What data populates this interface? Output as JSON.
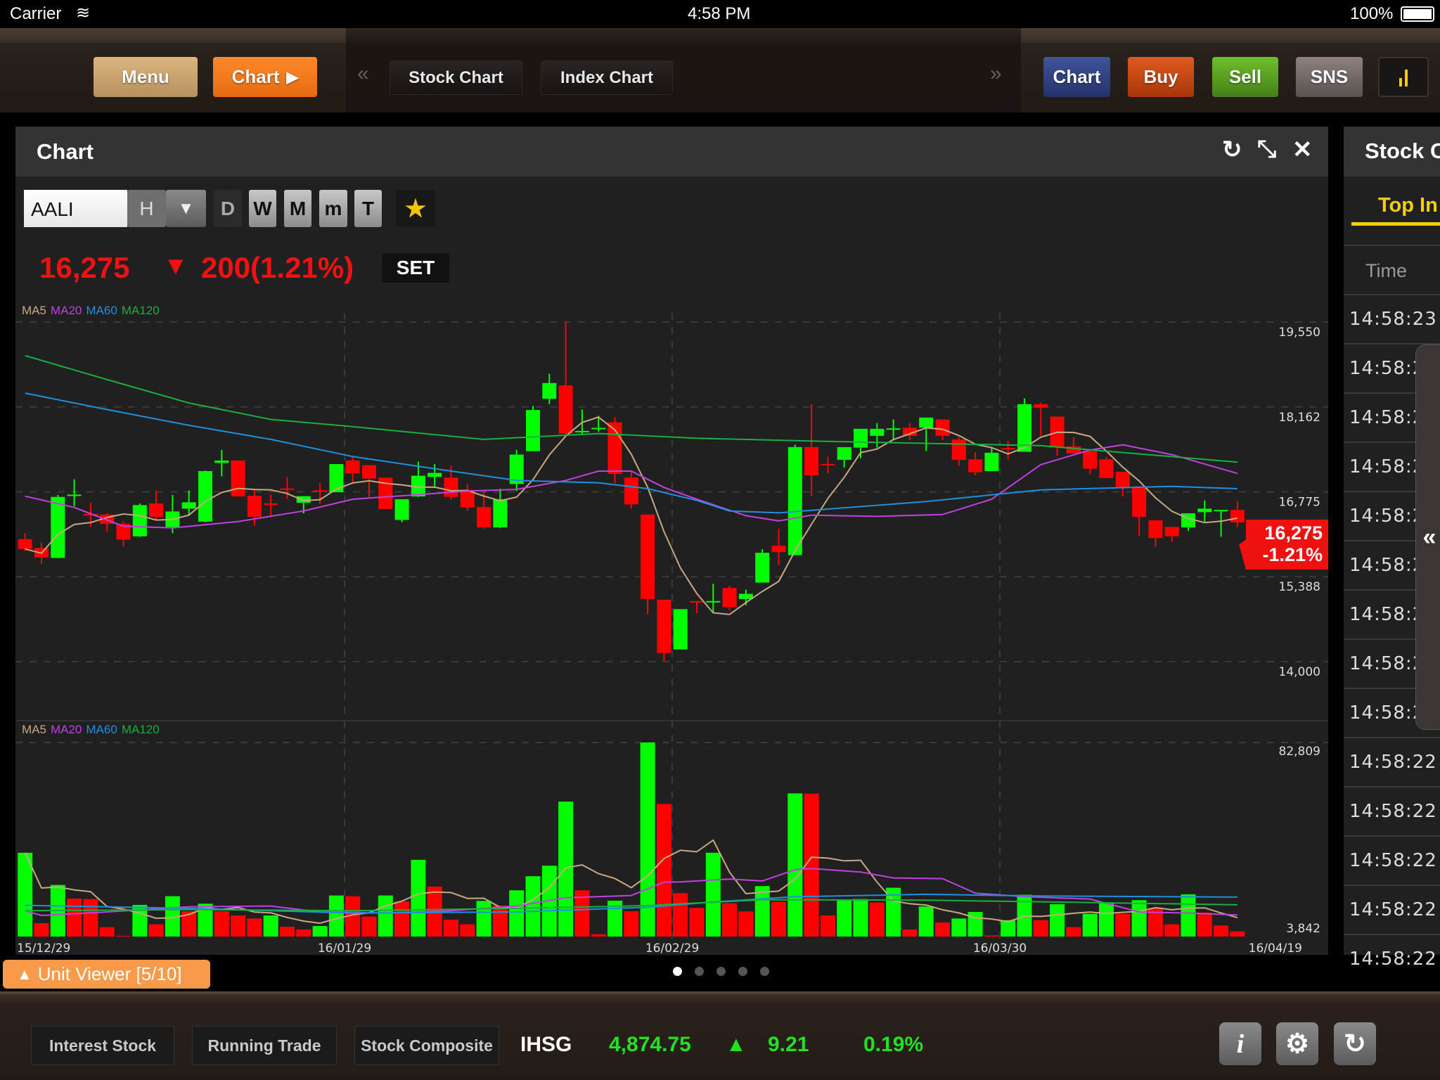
{
  "status_bar": {
    "carrier": "Carrier",
    "time": "4:58 PM",
    "battery": "100%"
  },
  "top_toolbar": {
    "menu": "Menu",
    "chart": "Chart",
    "chart_arrow": "▶",
    "prev": "«",
    "next": "»",
    "tabs": [
      "Stock Chart",
      "Index Chart"
    ],
    "right_buttons": [
      {
        "label": "Chart",
        "color": "#2d3e80"
      },
      {
        "label": "Buy",
        "color": "#c7420c"
      },
      {
        "label": "Sell",
        "color": "#4e9a1a"
      },
      {
        "label": "SNS",
        "color": "#6e6563"
      }
    ],
    "signal_icon": "bar-signal-icon"
  },
  "chart_panel": {
    "title": "Chart",
    "refresh_icon": "↻",
    "collapse_icon": "⤡",
    "close_icon": "✕",
    "symbol": "AALI",
    "period_selected": "H",
    "dropdown_icon": "▼",
    "periods": [
      "D",
      "W",
      "M",
      "m",
      "T"
    ],
    "favorite_icon": "★",
    "price": "16,275",
    "change_arrow": "▼",
    "change": "200(1.21%)",
    "market": "SET",
    "ma_legend": [
      {
        "label": "MA5",
        "color": "#c8a883"
      },
      {
        "label": "MA20",
        "color": "#c040e0"
      },
      {
        "label": "MA60",
        "color": "#1e90e0"
      },
      {
        "label": "MA120",
        "color": "#18b040"
      }
    ],
    "price_tag": {
      "price": "16,275",
      "change": "-1.21%"
    },
    "page_dots": {
      "count": 5,
      "active": 1
    }
  },
  "unit_viewer": {
    "icon": "▲",
    "label": "Unit Viewer [5/10]"
  },
  "right_panel": {
    "title": "Stock C",
    "tab": "Top In",
    "column": "Time",
    "times": [
      "14:58:23",
      "14:58:2",
      "14:58:2",
      "14:58:2",
      "14:58:2",
      "14:58:2",
      "14:58:2",
      "14:58:2",
      "14:58:2",
      "14:58:22",
      "14:58:22",
      "14:58:22",
      "14:58:22",
      "14:58:22"
    ],
    "handle_icon": "«"
  },
  "bottom_bar": {
    "buttons": [
      "Interest Stock",
      "Running Trade",
      "Stock Composite"
    ],
    "index_name": "IHSG",
    "index_value": "4,874.75",
    "index_arrow": "▲",
    "index_change": "9.21",
    "index_pct": "0.19%",
    "icons": [
      {
        "name": "info-icon",
        "glyph": "i"
      },
      {
        "name": "gear-icon",
        "glyph": "⚙"
      },
      {
        "name": "logout-icon",
        "glyph": "↻"
      }
    ]
  },
  "chart_data": [
    {
      "type": "candlestick",
      "ohlc_order": [
        "open",
        "high",
        "low",
        "close"
      ],
      "up_color": "#00ff00",
      "down_color": "#ff0000",
      "ylim": [
        14000,
        19550
      ],
      "y_ticks": [
        "19,550",
        "18,162",
        "16,775",
        "15,388",
        "14,000"
      ],
      "y_tick_values": [
        19550,
        18162,
        16775,
        15388,
        14000
      ],
      "x_labels": [
        {
          "index": 0,
          "label": "15/12/29"
        },
        {
          "index": 19.5,
          "label": "16/01/29"
        },
        {
          "index": 39.5,
          "label": "16/02/29"
        },
        {
          "index": 59.5,
          "label": "16/03/30"
        },
        {
          "index": 74,
          "label": "16/04/19"
        }
      ],
      "ohlc": [
        [
          16002,
          16098,
          15810,
          15841
        ],
        [
          15856,
          15944,
          15599,
          15703
        ],
        [
          15695,
          16723,
          15687,
          16692
        ],
        [
          16715,
          16980,
          16539,
          16730
        ],
        [
          16414,
          16596,
          16201,
          16400
        ],
        [
          16404,
          16424,
          16124,
          16251
        ],
        [
          16251,
          16290,
          15879,
          15994
        ],
        [
          16048,
          16585,
          16040,
          16558
        ],
        [
          16585,
          16796,
          16316,
          16366
        ],
        [
          16201,
          16723,
          16098,
          16454
        ],
        [
          16500,
          16796,
          16385,
          16604
        ],
        [
          16289,
          17122,
          16278,
          17114
        ],
        [
          17248,
          17460,
          17030,
          17286
        ],
        [
          17287,
          17287,
          16700,
          16700
        ],
        [
          16711,
          16808,
          16224,
          16366
        ],
        [
          16585,
          16731,
          16366,
          16570
        ],
        [
          16830,
          17018,
          16654,
          16815
        ],
        [
          16596,
          16704,
          16424,
          16704
        ],
        [
          16800,
          16922,
          16577,
          16780
        ],
        [
          16769,
          17229,
          16769,
          17229
        ],
        [
          17287,
          17345,
          16922,
          17076
        ],
        [
          17210,
          17210,
          16692,
          16992
        ],
        [
          17007,
          17007,
          16493,
          16493
        ],
        [
          16316,
          16654,
          16278,
          16654
        ],
        [
          16700,
          17268,
          16692,
          17038
        ],
        [
          17019,
          17229,
          16865,
          17084
        ],
        [
          17007,
          17199,
          16654,
          16692
        ],
        [
          16807,
          16903,
          16470,
          16520
        ],
        [
          16527,
          16796,
          16174,
          16194
        ],
        [
          16194,
          16826,
          16182,
          16654
        ],
        [
          16903,
          17460,
          16788,
          17383
        ],
        [
          17440,
          18181,
          17440,
          18112
        ],
        [
          18296,
          18706,
          18207,
          18553
        ],
        [
          18514,
          19550,
          17709,
          17728
        ],
        [
          17747,
          18119,
          17709,
          17770
        ],
        [
          17805,
          18016,
          17759,
          17820
        ],
        [
          17912,
          18000,
          16915,
          17068
        ],
        [
          17007,
          17114,
          16500,
          16570
        ],
        [
          16404,
          16404,
          14774,
          15024
        ],
        [
          15012,
          15012,
          14007,
          14141
        ],
        [
          14199,
          14858,
          14199,
          14858
        ],
        [
          14990,
          14990,
          14794,
          14975
        ],
        [
          14975,
          15273,
          14794,
          14990
        ],
        [
          15204,
          15242,
          14832,
          14889
        ],
        [
          15024,
          15177,
          14920,
          15108
        ],
        [
          15292,
          15840,
          15292,
          15779
        ],
        [
          15894,
          16174,
          15580,
          15791
        ],
        [
          15741,
          17544,
          15741,
          17506
        ],
        [
          17506,
          18207,
          16700,
          17045
        ],
        [
          17230,
          17352,
          17076,
          17215
        ],
        [
          17298,
          17505,
          17172,
          17505
        ],
        [
          17498,
          17805,
          17325,
          17805
        ],
        [
          17690,
          17900,
          17498,
          17805
        ],
        [
          17805,
          17958,
          17632,
          17812
        ],
        [
          17824,
          17900,
          17620,
          17690
        ],
        [
          17824,
          17989,
          17440,
          17989
        ],
        [
          17958,
          17958,
          17620,
          17690
        ],
        [
          17632,
          17670,
          17199,
          17298
        ],
        [
          17306,
          17421,
          17045,
          17095
        ],
        [
          17114,
          17506,
          17114,
          17414
        ],
        [
          17490,
          17605,
          17306,
          17475
        ],
        [
          17429,
          18303,
          17429,
          18207
        ],
        [
          18207,
          18235,
          17690,
          18150
        ],
        [
          18004,
          18004,
          17364,
          17498
        ],
        [
          17517,
          17667,
          17402,
          17402
        ],
        [
          17440,
          17440,
          17057,
          17153
        ],
        [
          17306,
          17344,
          17000,
          17000
        ],
        [
          17103,
          17103,
          16700,
          16846
        ],
        [
          16865,
          16865,
          16059,
          16366
        ],
        [
          16309,
          16309,
          15879,
          16021
        ],
        [
          16202,
          16202,
          15956,
          16048
        ],
        [
          16194,
          16424,
          16136,
          16424
        ],
        [
          16443,
          16635,
          16289,
          16500
        ],
        [
          16470,
          16480,
          16040,
          16480
        ],
        [
          16480,
          16623,
          16201,
          16275
        ]
      ],
      "ma": [
        {
          "name": "MA5",
          "color": "#c8a883",
          "period": 5
        },
        {
          "name": "MA20",
          "color": "#c040e0",
          "points": [
            [
              0,
              16704
            ],
            [
              3,
              16520
            ],
            [
              6,
              16213
            ],
            [
              9,
              16186
            ],
            [
              13,
              16290
            ],
            [
              17,
              16462
            ],
            [
              20,
              16654
            ],
            [
              23,
              16711
            ],
            [
              27,
              16788
            ],
            [
              30,
              16815
            ],
            [
              33,
              16961
            ],
            [
              35,
              17114
            ],
            [
              37,
              17114
            ],
            [
              39,
              16846
            ],
            [
              41,
              16654
            ],
            [
              44,
              16385
            ],
            [
              46,
              16301
            ],
            [
              48,
              16393
            ],
            [
              52,
              16374
            ],
            [
              56,
              16404
            ],
            [
              59,
              16654
            ],
            [
              62,
              17220
            ],
            [
              65,
              17459
            ],
            [
              67,
              17544
            ],
            [
              70,
              17383
            ],
            [
              74,
              17076
            ]
          ]
        },
        {
          "name": "MA60",
          "color": "#1e90e0",
          "points": [
            [
              0,
              18388
            ],
            [
              5,
              18119
            ],
            [
              10,
              17862
            ],
            [
              15,
              17632
            ],
            [
              20,
              17352
            ],
            [
              25,
              17153
            ],
            [
              30,
              16961
            ],
            [
              35,
              16923
            ],
            [
              38,
              16827
            ],
            [
              41,
              16635
            ],
            [
              43,
              16462
            ],
            [
              46,
              16432
            ],
            [
              55,
              16616
            ],
            [
              62,
              16807
            ],
            [
              70,
              16865
            ],
            [
              74,
              16827
            ]
          ]
        },
        {
          "name": "MA120",
          "color": "#18b040",
          "points": [
            [
              0,
              19001
            ],
            [
              5,
              18610
            ],
            [
              10,
              18227
            ],
            [
              15,
              17958
            ],
            [
              20,
              17840
            ],
            [
              28,
              17632
            ],
            [
              35,
              17728
            ],
            [
              41,
              17651
            ],
            [
              48,
              17605
            ],
            [
              62,
              17530
            ],
            [
              74,
              17260
            ]
          ]
        }
      ]
    },
    {
      "type": "bar",
      "ylim": [
        3842,
        82809
      ],
      "y_ticks": [
        "82,809",
        "3,842"
      ],
      "y_tick_values": [
        82809,
        3842
      ],
      "values": [
        37936,
        9286,
        24852,
        19313,
        19122,
        7662,
        4129,
        16735,
        8808,
        20268,
        14156,
        17212,
        14156,
        12437,
        11196,
        12437,
        7853,
        6707,
        8140,
        20555,
        20268,
        11960,
        20555,
        18167,
        35071,
        24184,
        10718,
        8808,
        18358,
        16448,
        22656,
        28386,
        32683,
        58755,
        22656,
        4797,
        18454,
        14156,
        82809,
        57800,
        21510,
        15493,
        37936,
        17403,
        14061,
        24375,
        17976,
        62097,
        62000,
        12437,
        18836,
        19122,
        17690,
        23706,
        6707,
        16066,
        9572,
        11196,
        13870,
        4320,
        10527,
        20841,
        10527,
        17021,
        7662,
        13106,
        17690,
        13106,
        18645,
        15493,
        8808,
        21032,
        13583,
        8331,
        5943
      ],
      "ma": [
        {
          "name": "MA5",
          "color": "#c8a883",
          "period": 5
        },
        {
          "name": "MA20",
          "color": "#c040e0",
          "points": [
            [
              0,
              14347
            ],
            [
              1,
              12437
            ],
            [
              5,
              13870
            ],
            [
              10,
              15971
            ],
            [
              15,
              16257
            ],
            [
              18,
              13870
            ],
            [
              22,
              13392
            ],
            [
              26,
              14347
            ],
            [
              30,
              16257
            ],
            [
              33,
              19600
            ],
            [
              37,
              20555
            ],
            [
              39,
              25998
            ],
            [
              40,
              26094
            ],
            [
              43,
              27240
            ],
            [
              45,
              26476
            ],
            [
              47,
              31060
            ],
            [
              48,
              31537
            ],
            [
              51,
              30105
            ],
            [
              53,
              27717
            ],
            [
              56,
              27431
            ],
            [
              58,
              21510
            ],
            [
              61,
              20077
            ],
            [
              65,
              19122
            ],
            [
              68,
              13870
            ],
            [
              71,
              13392
            ],
            [
              74,
              12628
            ]
          ]
        },
        {
          "name": "MA60",
          "color": "#1e90e0",
          "points": [
            [
              0,
              16544
            ],
            [
              10,
              15302
            ],
            [
              20,
              13392
            ],
            [
              30,
              13870
            ],
            [
              38,
              15780
            ],
            [
              42,
              17881
            ],
            [
              47,
              20077
            ],
            [
              55,
              21032
            ],
            [
              62,
              20364
            ],
            [
              74,
              19886
            ]
          ]
        },
        {
          "name": "MA120",
          "color": "#18b040",
          "points": [
            [
              0,
              14347
            ],
            [
              10,
              14825
            ],
            [
              20,
              14347
            ],
            [
              30,
              15302
            ],
            [
              38,
              16448
            ],
            [
              45,
              18836
            ],
            [
              55,
              18645
            ],
            [
              65,
              17690
            ],
            [
              74,
              16735
            ]
          ]
        }
      ]
    }
  ]
}
